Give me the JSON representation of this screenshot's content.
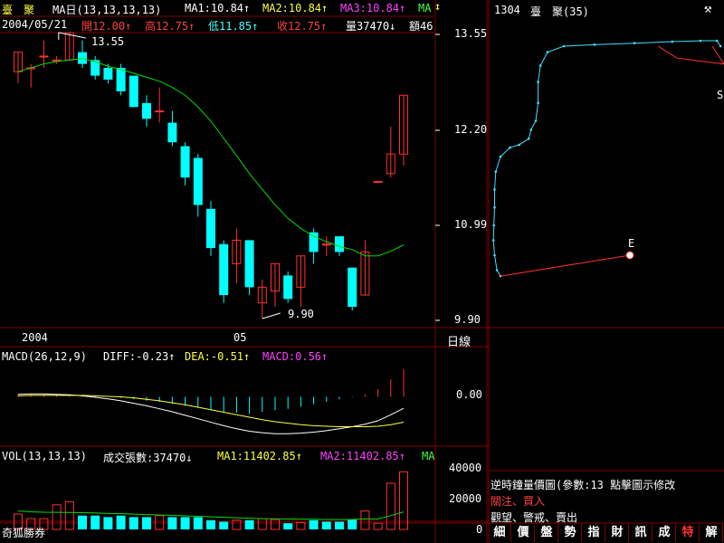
{
  "stock": {
    "name": "臺　聚",
    "code": "1304",
    "name_short": "臺　聚(35)"
  },
  "header": {
    "ma_label": "MA日(13,13,13,13)",
    "ma1": "MA1:10.84↑",
    "ma2": "MA2:10.84↑",
    "ma3": "MA3:10.84↑",
    "ma4": "MA"
  },
  "quote": {
    "date": "2004/05/21",
    "open": "開12.00↑",
    "high": "高12.75↑",
    "low": "低11.85↑",
    "close": "收12.75↑",
    "volume": "量37470↓",
    "amount": "額46"
  },
  "price_panel": {
    "axis_ticks": [
      "13.55",
      "12.20",
      "10.99",
      "9.90"
    ],
    "high_marker": "13.55",
    "low_marker": "9.90",
    "x_labels": [
      "2004",
      "05"
    ],
    "period_label": "日線"
  },
  "macd_panel": {
    "label": "MACD(26,12,9)",
    "diff": "DIFF:-0.23↑",
    "dea": "DEA:-0.51↑",
    "macd": "MACD:0.56↑",
    "axis_tick": "0.00"
  },
  "vol_panel": {
    "label": "VOL(13,13,13)",
    "total": "成交張數:37470↓",
    "ma1": "MA1:11402.85↑",
    "ma2": "MA2:11402.85↑",
    "ma3": "MA",
    "axis_ticks": [
      "40000",
      "20000",
      "0"
    ]
  },
  "rp_panel": {
    "marker_label": "E",
    "edge_mark": "S",
    "title": "逆時鐘量價圖(參數:13 點擊圖示修改",
    "link1": "關注、買入",
    "link2": "觀望、警戒、賣出"
  },
  "watermark": "奇狐勝券",
  "tabs": [
    "細",
    "價",
    "盤",
    "勢",
    "指",
    "財",
    "訊",
    "成",
    "特",
    "解"
  ],
  "active_tab": "特",
  "colors": {
    "up": "#ff3030",
    "down": "#00ffff",
    "ma_line": "#00dd00",
    "yellow": "#ffff40",
    "magenta": "#ff40ff",
    "grid": "#800000"
  },
  "chart_data": {
    "type": "candlestick",
    "title": "臺聚 1304 日線",
    "ylim": [
      9.9,
      13.55
    ],
    "candles": [
      {
        "o": 13.05,
        "h": 13.3,
        "l": 12.9,
        "c": 13.3
      },
      {
        "o": 13.1,
        "h": 13.15,
        "l": 12.85,
        "c": 13.1
      },
      {
        "o": 13.25,
        "h": 13.45,
        "l": 13.1,
        "c": 13.25
      },
      {
        "o": 13.2,
        "h": 13.25,
        "l": 13.15,
        "c": 13.2
      },
      {
        "o": 13.2,
        "h": 13.55,
        "l": 13.2,
        "c": 13.55
      },
      {
        "o": 13.3,
        "h": 13.45,
        "l": 13.1,
        "c": 13.15
      },
      {
        "o": 13.2,
        "h": 13.25,
        "l": 12.95,
        "c": 13.0
      },
      {
        "o": 13.1,
        "h": 13.15,
        "l": 12.9,
        "c": 12.95
      },
      {
        "o": 13.1,
        "h": 13.15,
        "l": 12.75,
        "c": 12.8
      },
      {
        "o": 13.0,
        "h": 13.0,
        "l": 12.6,
        "c": 12.6
      },
      {
        "o": 12.65,
        "h": 12.75,
        "l": 12.35,
        "c": 12.45
      },
      {
        "o": 12.55,
        "h": 12.85,
        "l": 12.4,
        "c": 12.55
      },
      {
        "o": 12.4,
        "h": 12.55,
        "l": 12.1,
        "c": 12.15
      },
      {
        "o": 12.1,
        "h": 12.15,
        "l": 11.6,
        "c": 11.7
      },
      {
        "o": 11.95,
        "h": 12.0,
        "l": 11.2,
        "c": 11.35
      },
      {
        "o": 11.3,
        "h": 11.4,
        "l": 10.7,
        "c": 10.8
      },
      {
        "o": 10.85,
        "h": 10.9,
        "l": 10.1,
        "c": 10.2
      },
      {
        "o": 10.6,
        "h": 11.05,
        "l": 10.35,
        "c": 10.9
      },
      {
        "o": 10.9,
        "h": 10.9,
        "l": 10.2,
        "c": 10.3
      },
      {
        "o": 10.1,
        "h": 10.4,
        "l": 9.9,
        "c": 10.3
      },
      {
        "o": 10.25,
        "h": 10.6,
        "l": 10.05,
        "c": 10.6
      },
      {
        "o": 10.45,
        "h": 10.5,
        "l": 10.1,
        "c": 10.15
      },
      {
        "o": 10.3,
        "h": 10.7,
        "l": 10.05,
        "c": 10.7
      },
      {
        "o": 11.0,
        "h": 11.05,
        "l": 10.6,
        "c": 10.75
      },
      {
        "o": 10.85,
        "h": 10.95,
        "l": 10.7,
        "c": 10.85
      },
      {
        "o": 10.95,
        "h": 10.95,
        "l": 10.7,
        "c": 10.75
      },
      {
        "o": 10.55,
        "h": 10.55,
        "l": 10.0,
        "c": 10.05
      },
      {
        "o": 10.2,
        "h": 10.9,
        "l": 10.2,
        "c": 10.75
      },
      {
        "o": 11.65,
        "h": 11.65,
        "l": 11.65,
        "c": 11.65
      },
      {
        "o": 11.75,
        "h": 12.35,
        "l": 11.7,
        "c": 12.0
      },
      {
        "o": 12.0,
        "h": 12.75,
        "l": 11.85,
        "c": 12.75
      }
    ],
    "ma13": [
      13.05,
      13.1,
      13.15,
      13.18,
      13.2,
      13.22,
      13.18,
      13.12,
      13.08,
      13.03,
      12.98,
      12.93,
      12.85,
      12.75,
      12.6,
      12.42,
      12.2,
      11.98,
      11.75,
      11.55,
      11.35,
      11.18,
      11.05,
      10.95,
      10.88,
      10.82,
      10.78,
      10.7,
      10.7,
      10.76,
      10.84
    ],
    "volume": [
      10000,
      7000,
      7000,
      16000,
      18000,
      9000,
      9000,
      8000,
      9000,
      8000,
      8000,
      9000,
      8000,
      8000,
      8000,
      6000,
      5000,
      6000,
      6000,
      7000,
      6500,
      4000,
      4500,
      6000,
      5000,
      5000,
      6500,
      12000,
      4000,
      30000,
      37470
    ],
    "volume_up": [
      true,
      true,
      true,
      true,
      true,
      false,
      false,
      false,
      false,
      false,
      false,
      true,
      false,
      false,
      false,
      false,
      false,
      true,
      false,
      true,
      true,
      false,
      true,
      false,
      false,
      false,
      false,
      true,
      true,
      true,
      true
    ],
    "vol_ma": [
      12000,
      11500,
      11200,
      11100,
      11000,
      10900,
      10700,
      10400,
      10200,
      9900,
      9600,
      9400,
      9100,
      8800,
      8500,
      8200,
      7900,
      7600,
      7300,
      7000,
      6900,
      6800,
      6700,
      6600,
      6500,
      6400,
      6400,
      6900,
      6800,
      9000,
      11402.85
    ],
    "vol_ylim": [
      0,
      40000
    ],
    "macd_hist": [
      0.05,
      0.05,
      0.05,
      0.05,
      0.04,
      0.03,
      0.02,
      0.01,
      -0.02,
      -0.05,
      -0.08,
      -0.1,
      -0.14,
      -0.18,
      -0.22,
      -0.26,
      -0.3,
      -0.32,
      -0.34,
      -0.3,
      -0.27,
      -0.24,
      -0.2,
      -0.15,
      -0.1,
      -0.05,
      -0.01,
      0.05,
      0.15,
      0.35,
      0.56
    ],
    "macd_diff": [
      0.05,
      0.06,
      0.06,
      0.05,
      0.04,
      0.02,
      -0.01,
      -0.04,
      -0.08,
      -0.13,
      -0.18,
      -0.24,
      -0.3,
      -0.37,
      -0.44,
      -0.51,
      -0.58,
      -0.64,
      -0.69,
      -0.72,
      -0.74,
      -0.74,
      -0.73,
      -0.71,
      -0.68,
      -0.64,
      -0.6,
      -0.55,
      -0.48,
      -0.36,
      -0.23
    ],
    "macd_dea": [
      0.02,
      0.03,
      0.03,
      0.03,
      0.03,
      0.03,
      0.02,
      0.01,
      0.0,
      -0.02,
      -0.05,
      -0.08,
      -0.12,
      -0.16,
      -0.21,
      -0.26,
      -0.31,
      -0.36,
      -0.41,
      -0.46,
      -0.5,
      -0.53,
      -0.56,
      -0.58,
      -0.59,
      -0.6,
      -0.6,
      -0.6,
      -0.59,
      -0.56,
      -0.51
    ],
    "macd_ylim": [
      -0.9,
      0.7
    ],
    "rp_curve": [
      [
        0.985,
        0.1
      ],
      [
        0.97,
        0.082
      ],
      [
        0.9,
        0.082
      ],
      [
        0.78,
        0.085
      ],
      [
        0.62,
        0.09
      ],
      [
        0.45,
        0.095
      ],
      [
        0.32,
        0.1
      ],
      [
        0.25,
        0.12
      ],
      [
        0.22,
        0.165
      ],
      [
        0.21,
        0.22
      ],
      [
        0.21,
        0.29
      ],
      [
        0.2,
        0.35
      ],
      [
        0.18,
        0.38
      ],
      [
        0.17,
        0.41
      ],
      [
        0.13,
        0.43
      ],
      [
        0.09,
        0.44
      ],
      [
        0.05,
        0.47
      ],
      [
        0.03,
        0.52
      ],
      [
        0.025,
        0.58
      ],
      [
        0.025,
        0.64
      ],
      [
        0.022,
        0.7
      ],
      [
        0.02,
        0.75
      ],
      [
        0.025,
        0.8
      ],
      [
        0.035,
        0.85
      ],
      [
        0.05,
        0.87
      ]
    ],
    "rp_red_end": [
      [
        0.05,
        0.87
      ],
      [
        0.6,
        0.8
      ]
    ],
    "rp_red_start": [
      [
        0.95,
        0.1
      ],
      [
        1.0,
        0.16
      ],
      [
        0.8,
        0.14
      ],
      [
        0.74,
        0.11
      ],
      [
        0.72,
        0.1
      ]
    ]
  }
}
